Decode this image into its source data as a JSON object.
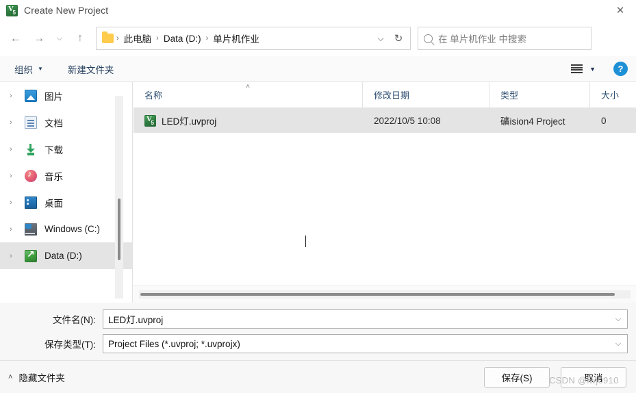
{
  "window": {
    "title": "Create New Project",
    "app_icon": "keil-uvision-icon",
    "close_label": "✕"
  },
  "nav": {
    "back": "←",
    "forward": "→",
    "recent": "⌵",
    "up": "↑",
    "folder_icon": "folder-icon",
    "breadcrumbs": [
      "此电脑",
      "Data (D:)",
      "单片机作业"
    ],
    "separator": "›",
    "dropdown": "⌵",
    "refresh": "↻"
  },
  "search": {
    "icon": "search-icon",
    "placeholder": "在 单片机作业 中搜索"
  },
  "toolbar": {
    "organize_label": "组织",
    "organize_caret": "▼",
    "new_folder_label": "新建文件夹",
    "view_caret": "▼",
    "help_label": "?"
  },
  "sidebar": {
    "expand_caret": "›",
    "items": [
      {
        "label": "图片",
        "icon": "pictures-icon",
        "selected": false
      },
      {
        "label": "文档",
        "icon": "documents-icon",
        "selected": false
      },
      {
        "label": "下载",
        "icon": "downloads-icon",
        "selected": false
      },
      {
        "label": "音乐",
        "icon": "music-icon",
        "selected": false
      },
      {
        "label": "桌面",
        "icon": "desktop-icon",
        "selected": false
      },
      {
        "label": "Windows (C:)",
        "icon": "drive-icon",
        "selected": false
      },
      {
        "label": "Data (D:)",
        "icon": "network-drive-icon",
        "selected": true
      }
    ]
  },
  "filelist": {
    "columns": [
      {
        "label": "名称",
        "sorted": true,
        "sort_caret": "˄"
      },
      {
        "label": "修改日期",
        "sorted": false
      },
      {
        "label": "类型",
        "sorted": false
      },
      {
        "label": "大小",
        "sorted": false
      }
    ],
    "rows": [
      {
        "name": "LED灯.uvproj",
        "icon": "uvision-project-icon",
        "date": "2022/10/5 10:08",
        "type": "礦ision4 Project",
        "size": "0",
        "selected": true
      }
    ]
  },
  "form": {
    "filename_label": "文件名(N):",
    "filename_value": "LED灯.uvproj",
    "filetype_label": "保存类型(T):",
    "filetype_value": "Project Files (*.uvproj; *.uvprojx)",
    "combo_arrow": "⌵"
  },
  "footer": {
    "hide_folders_caret": "˄",
    "hide_folders_label": "隐藏文件夹",
    "save_label": "保存(S)",
    "cancel_label": "取消"
  },
  "watermark": {
    "text": "CSDN @lwj0910"
  },
  "colors": {
    "selection": "#e4e4e4",
    "accent_blue": "#1e90d6",
    "header_text": "#2f4f73",
    "folder_yellow": "#ffcb4d"
  }
}
